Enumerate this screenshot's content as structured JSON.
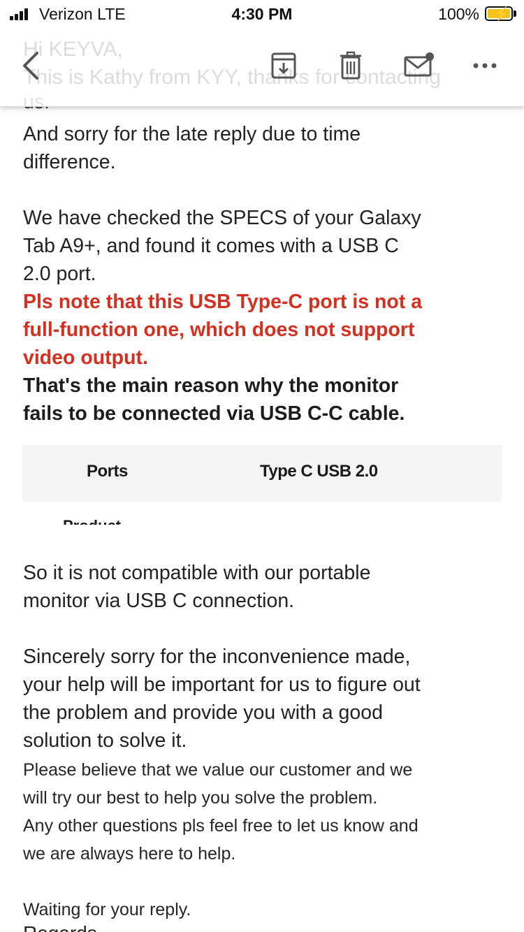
{
  "status_bar": {
    "carrier": "Verizon  LTE",
    "time": "4:30 PM",
    "battery_percent": "100%"
  },
  "toolbar": {
    "behind_text_1": "Hi KEYVA,",
    "behind_text_2": "This is Kathy from KYY, thanks for contacting",
    "icons": [
      "chevron-left-icon",
      "archive-icon",
      "trash-icon",
      "mark-unread-icon",
      "more-icon"
    ]
  },
  "email": {
    "cut_line": "us.",
    "para1_line1": "And sorry for the late reply due to time",
    "para1_line2": "difference.",
    "para2_line1": "We have checked the SPECS of your Galaxy",
    "para2_line2": "Tab A9+, and found it comes with a USB C",
    "para2_line3": "2.0 port.",
    "red_line1": "Pls note that this USB Type-C port is not a",
    "red_line2": "full-function one, which does not support",
    "red_line3": "video output.",
    "bold_line1": "That's the main reason why the monitor",
    "bold_line2": "fails to be connected via USB C-C cable.",
    "spec": {
      "key": "Ports",
      "value": "Type C USB 2.0",
      "next_key_cut": "Product"
    },
    "para3_line1": "So it is not compatible with our portable",
    "para3_line2": "monitor via USB C connection.",
    "para4_line1": "Sincerely sorry for the inconvenience made,",
    "para4_line2": "your help will be important for us to figure out",
    "para4_line3": "the problem and provide you with a good",
    "para4_line4": "solution to solve it.",
    "small_line1": "Please believe that we value our customer and we",
    "small_line2": "will try our best to help you solve the problem.",
    "small_line3": "Any other questions pls feel free to let us know and",
    "small_line4": "we are always here to help.",
    "waiting": "Waiting for your reply.",
    "closing_cut": "Regards,"
  },
  "colors": {
    "highlight_red": "#d5301f",
    "battery_yellow": "#f2c31b",
    "spec_table_bg": "#f4f4f4"
  }
}
